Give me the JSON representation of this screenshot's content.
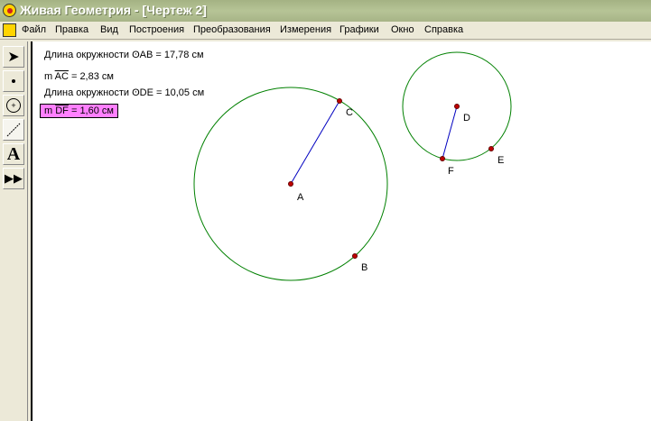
{
  "window": {
    "title": "Живая Геометрия - [Чертеж 2]"
  },
  "menu": [
    "Файл",
    "Правка",
    "Вид",
    "Построения",
    "Преобразования",
    "Измерения",
    "Графики",
    "Окно",
    "Справка"
  ],
  "measurements": {
    "m1_prefix": "Длина окружности ",
    "m1_obj": "AB",
    "m1_val": " = 17,78 см",
    "m2_prefix": "m ",
    "m2_obj": "AC",
    "m2_val": " = 2,83 см",
    "m3_prefix": "Длина окружности ",
    "m3_obj": "DE",
    "m3_val": " = 10,05 см",
    "m4_prefix": "m ",
    "m4_obj": "DF",
    "m4_val": " = 1,60 см"
  },
  "points": {
    "A": "A",
    "B": "B",
    "C": "C",
    "D": "D",
    "E": "E",
    "F": "F"
  },
  "colors": {
    "circle": "#008000",
    "segment": "#0000c0",
    "point": "#c00000",
    "highlight": "#ff80ff"
  }
}
